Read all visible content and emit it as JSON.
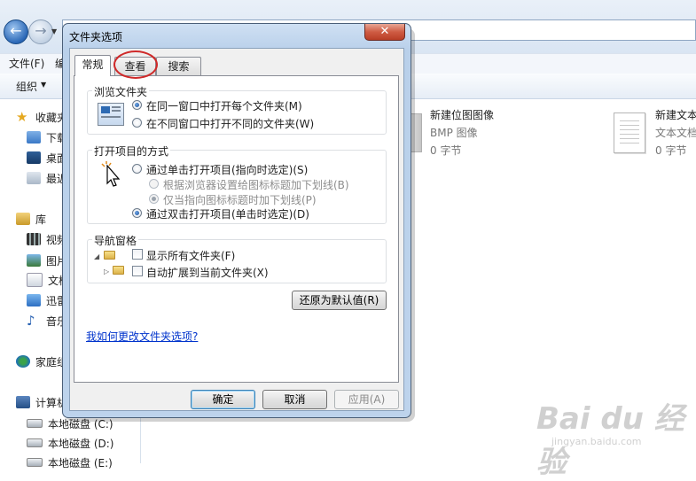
{
  "explorer": {
    "menu": [
      "文件(F)",
      "编"
    ],
    "toolbar": {
      "organize": "组织"
    },
    "nav": {
      "favorites": "收藏夹",
      "favorites_items": [
        "下载",
        "桌面",
        "最近"
      ],
      "libraries": "库",
      "library_items": [
        "视频",
        "图片",
        "文档",
        "迅雷",
        "音乐"
      ],
      "homegroup": "家庭组",
      "computer": "计算机",
      "drives": [
        "本地磁盘 (C:)",
        "本地磁盘 (D:)",
        "本地磁盘 (E:)"
      ]
    },
    "files": [
      {
        "name": "新建位图图像",
        "type": "BMP 图像",
        "size": "0 字节"
      },
      {
        "name": "新建文本",
        "type": "文本文档",
        "size": "0 字节"
      }
    ]
  },
  "dialog": {
    "title": "文件夹选项",
    "close": "✕",
    "tabs": [
      "常规",
      "查看",
      "搜索"
    ],
    "browse_group": {
      "label": "浏览文件夹",
      "options": [
        "在同一窗口中打开每个文件夹(M)",
        "在不同窗口中打开不同的文件夹(W)"
      ]
    },
    "click_group": {
      "label": "打开项目的方式",
      "single_click": "通过单击打开项目(指向时选定)(S)",
      "underline_browser": "根据浏览器设置给图标标题加下划线(B)",
      "underline_point": "仅当指向图标标题时加下划线(P)",
      "double_click": "通过双击打开项目(单击时选定)(D)"
    },
    "nav_group": {
      "label": "导航窗格",
      "show_all": "显示所有文件夹(F)",
      "auto_expand": "自动扩展到当前文件夹(X)"
    },
    "restore": "还原为默认值(R)",
    "help_link": "我如何更改文件夹选项?",
    "buttons": {
      "ok": "确定",
      "cancel": "取消",
      "apply": "应用(A)"
    }
  },
  "watermark": {
    "main": "Bai du 经验",
    "sub": "jingyan.baidu.com"
  }
}
